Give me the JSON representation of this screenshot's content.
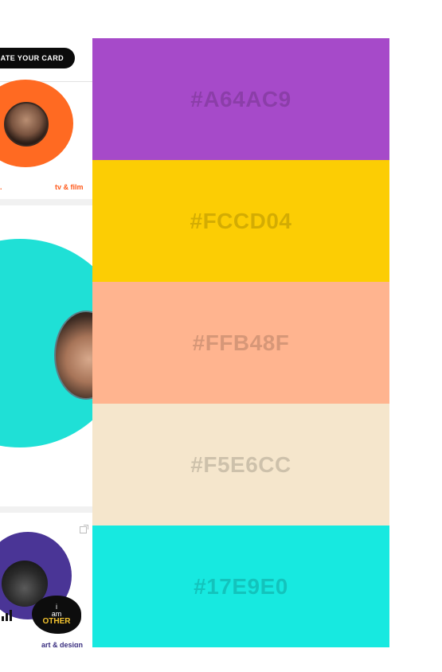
{
  "app_fragment": {
    "create_button_label": "ATE YOUR CARD",
    "card1_tags": [
      ".",
      "tv & film"
    ],
    "card3_tag": "art & design",
    "badge": {
      "line1": "i",
      "line2": "am",
      "line3": "OTHER"
    }
  },
  "palette": {
    "swatches": [
      {
        "hex": "#A64AC9",
        "label": "#A64AC9"
      },
      {
        "hex": "#FCCD04",
        "label": "#FCCD04"
      },
      {
        "hex": "#FFB48F",
        "label": "#FFB48F"
      },
      {
        "hex": "#F5E6CC",
        "label": "#F5E6CC"
      },
      {
        "hex": "#17E9E0",
        "label": "#17E9E0"
      }
    ]
  },
  "colors": {
    "card1_accent": "#ff6a22",
    "card2_accent": "#1fe0d6",
    "card3_accent": "#4a3596"
  }
}
